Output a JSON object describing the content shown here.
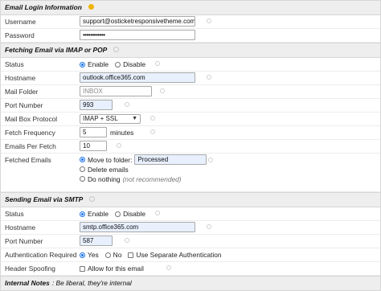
{
  "login": {
    "section_title": "Email Login Information",
    "username_label": "Username",
    "username_value": "support@osticketresponsivetheme.com",
    "password_label": "Password",
    "password_value": "••••••••••••"
  },
  "fetching": {
    "section_title": "Fetching Email via IMAP or POP",
    "status_label": "Status",
    "enable_label": "Enable",
    "disable_label": "Disable",
    "hostname_label": "Hostname",
    "hostname_value": "outlook.office365.com",
    "mail_folder_label": "Mail Folder",
    "mail_folder_placeholder": "INBOX",
    "port_label": "Port Number",
    "port_value": "993",
    "protocol_label": "Mail Box Protocol",
    "protocol_value": "IMAP + SSL",
    "frequency_label": "Fetch Frequency",
    "frequency_value": "5",
    "frequency_unit": "minutes",
    "per_fetch_label": "Emails Per Fetch",
    "per_fetch_value": "10",
    "fetched_label": "Fetched Emails",
    "move_label": "Move to folder:",
    "move_value": "Processed",
    "delete_label": "Delete emails",
    "nothing_label": "Do nothing",
    "nothing_note": "(not recommended)"
  },
  "sending": {
    "section_title": "Sending Email via SMTP",
    "status_label": "Status",
    "enable_label": "Enable",
    "disable_label": "Disable",
    "hostname_label": "Hostname",
    "hostname_value": "smtp.office365.com",
    "port_label": "Port Number",
    "port_value": "587",
    "auth_label": "Authentication Required",
    "yes_label": "Yes",
    "no_label": "No",
    "separate_auth_label": "Use Separate Authentication",
    "spoofing_label": "Header Spoofing",
    "allow_label": "Allow for this email"
  },
  "notes": {
    "title": "Internal Notes",
    "value": ": Be liberal, they're internal"
  },
  "colors": {
    "help_accent": "#f0b400",
    "radio_selected": "#1a73e8",
    "autofill_bg": "#e8f0fe",
    "section_bg": "#eeeeee"
  }
}
